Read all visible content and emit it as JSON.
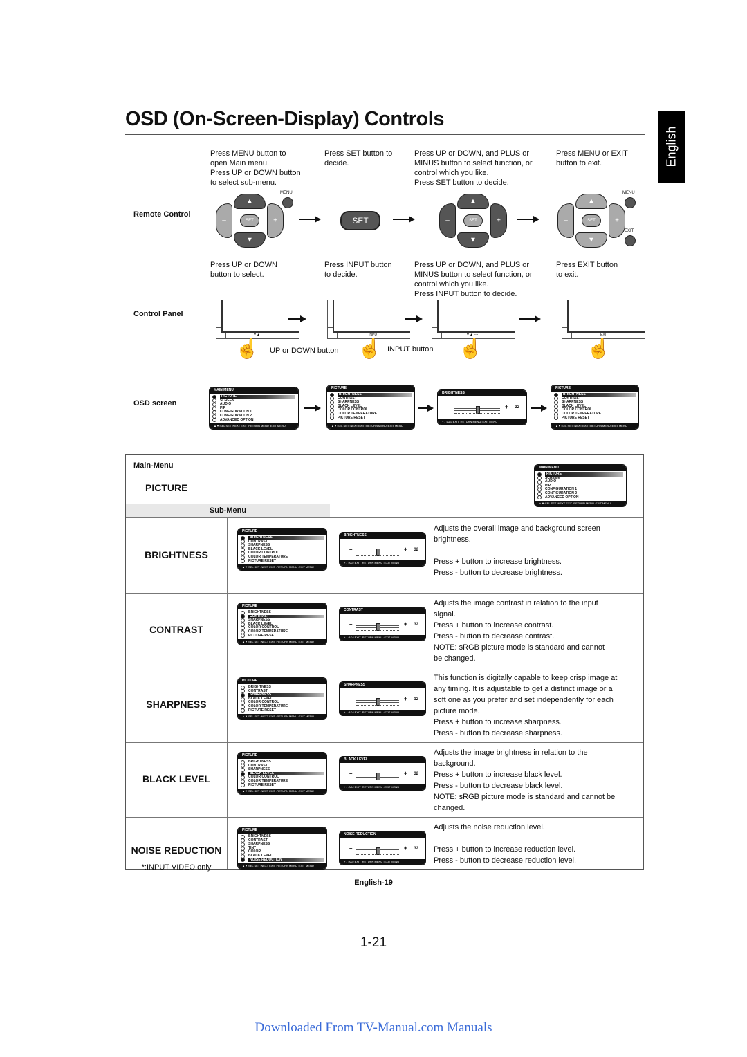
{
  "page": {
    "title": "OSD (On-Screen-Display) Controls",
    "language_tab": "English",
    "page_number": "1-21",
    "inner_page_number": "English-19",
    "footer_link": "Downloaded From TV-Manual.com Manuals",
    "link_color": "#3a6bd8"
  },
  "steps": {
    "remote_label": "Remote Control",
    "control_panel_label": "Control Panel",
    "osd_screen_label": "OSD screen",
    "remote_instructions": [
      "Press MENU button to\nopen Main menu.\nPress UP or DOWN button\nto select sub-menu.",
      "Press SET button to\ndecide.",
      "Press UP or DOWN, and PLUS or\nMINUS button to select function, or\ncontrol which you like.\nPress SET button to decide.",
      "Press MENU or EXIT\nbutton to exit."
    ],
    "panel_instructions": [
      "Press UP or DOWN\nbutton to select.",
      "Press INPUT button\nto decide.",
      "Press UP or DOWN, and PLUS or\nMINUS button to select function, or\ncontrol which you like.\nPress INPUT button to decide.",
      "Press EXIT button\nto exit."
    ],
    "remote_buttons": {
      "menu": "MENU",
      "exit": "EXIT",
      "set": "SET",
      "minus": "–",
      "plus": "+",
      "up": "▲",
      "down": "▼"
    },
    "panel_callouts": {
      "updown": "UP or DOWN button",
      "input": "INPUT button"
    },
    "panel_keys": [
      "▼▲",
      "INPUT",
      "▼▲ −+",
      "EXIT"
    ]
  },
  "osd": {
    "main_menu": {
      "header": "MAIN MENU",
      "items": [
        "PICTURE",
        "SCREEN",
        "AUDIO",
        "PIP",
        "CONFIGURATION 1",
        "CONFIGURATION 2",
        "ADVANCED OPTION"
      ],
      "selected": 0
    },
    "picture_menu": {
      "header": "PICTURE",
      "items": [
        "BRIGHTNESS",
        "CONTRAST",
        "SHARPNESS",
        "BLACK LEVEL",
        "COLOR CONTROL",
        "COLOR TEMPERATURE",
        "PICTURE RESET"
      ]
    },
    "picture_menu_video": {
      "header": "PICTURE",
      "items": [
        "BRIGHTNESS",
        "CONTRAST",
        "SHARPNESS",
        "TINT",
        "COLOR",
        "BLACK LEVEL",
        "NOISE REDUCTION"
      ]
    },
    "menu_footer": "▲▼:SEL  SET :NEXT  EXIT :RETURN  MENU :EXIT MENU",
    "slider_footer": "+ - :ADJ          EXIT :RETURN  MENU :EXIT MENU",
    "brightness_demo": {
      "header": "BRIGHTNESS",
      "value": "32",
      "level": 0.5
    }
  },
  "table": {
    "main_menu_label": "Main-Menu",
    "main_menu_name": "PICTURE",
    "sub_menu_label": "Sub-Menu",
    "rows": [
      {
        "name": "BRIGHTNESS",
        "note": "",
        "selected": 0,
        "menu": "picture_menu",
        "slider_header": "BRIGHTNESS",
        "value": "32",
        "level": 0.5,
        "description": "Adjusts the overall image and background screen\nbrightness.\n\nPress + button to increase brightness.\nPress - button to decrease brightness."
      },
      {
        "name": "CONTRAST",
        "note": "",
        "selected": 1,
        "menu": "picture_menu",
        "slider_header": "CONTRAST",
        "value": "32",
        "level": 0.5,
        "description": "Adjusts the image contrast in relation to the input\nsignal.\nPress + button to increase contrast.\nPress - button to decrease contrast.\nNOTE: sRGB picture mode is standard and cannot\nbe changed."
      },
      {
        "name": "SHARPNESS",
        "note": "",
        "selected": 2,
        "menu": "picture_menu",
        "slider_header": "SHARPNESS",
        "value": "12",
        "level": 0.5,
        "description": "This function is digitally capable to keep crisp image at\nany timing. It is adjustable to get a distinct image or a\nsoft one as you prefer and set independently for each\npicture mode.\nPress + button to increase sharpness.\nPress - button to decrease sharpness."
      },
      {
        "name": "BLACK LEVEL",
        "note": "",
        "selected": 3,
        "menu": "picture_menu",
        "slider_header": "BLACK LEVEL",
        "value": "32",
        "level": 0.5,
        "description": "Adjusts the image brightness in relation to the\nbackground.\nPress + button to increase black level.\nPress - button to decrease black level.\nNOTE: sRGB picture mode is standard and cannot be\nchanged."
      },
      {
        "name": "NOISE REDUCTION",
        "note": "*:INPUT VIDEO only",
        "selected": 6,
        "menu": "picture_menu_video",
        "slider_header": "NOISE REDUCTION",
        "value": "32",
        "level": 0.5,
        "description": "Adjusts the noise reduction level.\n\nPress + button to increase reduction level.\nPress - button to decrease reduction level."
      }
    ]
  }
}
